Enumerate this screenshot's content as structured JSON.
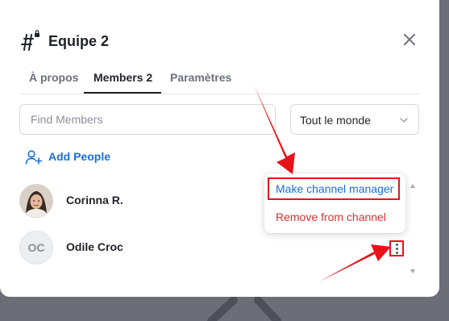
{
  "header": {
    "channel_icon": "hash-lock-icon",
    "title": "Equipe 2",
    "close_icon": "close-icon"
  },
  "tabs": [
    {
      "label": "À propos",
      "active": false
    },
    {
      "label": "Members 2",
      "active": true
    },
    {
      "label": "Paramètres",
      "active": false
    }
  ],
  "filters": {
    "search_placeholder": "Find Members",
    "search_value": "",
    "role_select": "Tout le monde",
    "role_chevron_icon": "chevron-down-icon"
  },
  "add_people": {
    "label": "Add People",
    "icon": "user-plus-icon"
  },
  "members": [
    {
      "name": "Corinna R.",
      "avatar": "photo"
    },
    {
      "name": "Odile Croc",
      "avatar_initials": "OC"
    }
  ],
  "member_menu": {
    "items": [
      {
        "label": "Make channel manager",
        "style": "primary"
      },
      {
        "label": "Remove from channel",
        "style": "danger"
      }
    ],
    "trigger_icon": "kebab-menu-icon"
  },
  "colors": {
    "accent": "#1a6fd6",
    "danger": "#d63333",
    "annotation": "#e8131a"
  }
}
